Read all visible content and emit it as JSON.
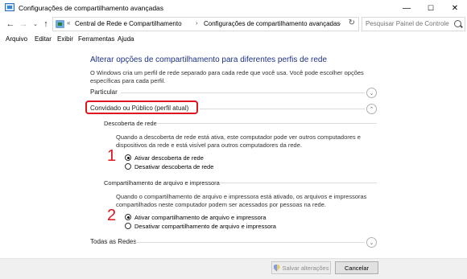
{
  "window": {
    "title": "Configurações de compartilhamento avançadas",
    "minimize": "—",
    "maximize": "☐",
    "close": "✕"
  },
  "address": {
    "overflow": "«",
    "crumbs": [
      "Central de Rede e Compartilhamento",
      "Configurações de compartilhamento avançadas"
    ],
    "separator": "›",
    "dropdown": "⌄",
    "refresh": "↻"
  },
  "search": {
    "placeholder": "Pesquisar Painel de Controle"
  },
  "menu": [
    "Arquivo",
    "Editar",
    "Exibir",
    "Ferramentas",
    "Ajuda"
  ],
  "main": {
    "heading": "Alterar opções de compartilhamento para diferentes perfis de rede",
    "description": "O Windows cria um perfil de rede separado para cada rede que você usa. Você pode escolher opções específicas para cada perfil.",
    "profiles": [
      {
        "label": "Particular",
        "expanded": false
      },
      {
        "label": "Convidado ou Público (perfil atual)",
        "expanded": true
      },
      {
        "label": "Todas as Redes",
        "expanded": false
      }
    ],
    "network_discovery": {
      "title": "Descoberta de rede",
      "description": "Quando a descoberta de rede está ativa, este computador pode ver outros computadores e dispositivos da rede e está visível para outros computadores da rede.",
      "options": [
        {
          "label": "Ativar descoberta de rede",
          "checked": true
        },
        {
          "label": "Desativar descoberta de rede",
          "checked": false
        }
      ],
      "marker": "1"
    },
    "file_sharing": {
      "title": "Compartilhamento de arquivo e impressora",
      "description": "Quando o compartilhamento de arquivo e impressora está ativado, os arquivos e impressoras compartilhados neste computador podem ser acessados por pessoas na rede.",
      "options": [
        {
          "label": "Ativar compartilhamento de arquivo e impressora",
          "checked": true
        },
        {
          "label": "Desativar compartilhamento de arquivo e impressora",
          "checked": false
        }
      ],
      "marker": "2"
    }
  },
  "footer": {
    "save_label": "Salvar alterações",
    "cancel_label": "Cancelar"
  },
  "colors": {
    "heading": "#1e3287",
    "annotation": "#e0141e"
  }
}
